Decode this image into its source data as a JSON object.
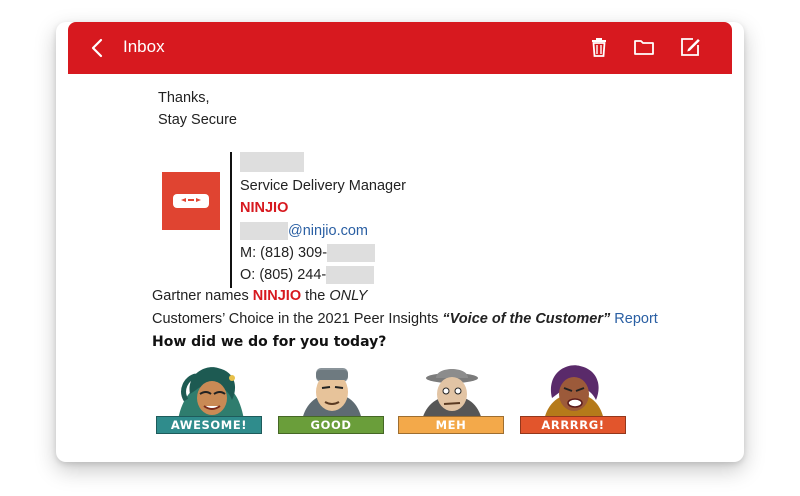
{
  "header": {
    "title": "Inbox"
  },
  "icons": {
    "back": "chevron-left-icon",
    "delete": "trash-icon",
    "folder": "folder-icon",
    "compose": "compose-icon"
  },
  "body": {
    "closing_line1": "Thanks,",
    "closing_line2": "Stay Secure"
  },
  "signature": {
    "role": "Service Delivery Manager",
    "company": "NINJIO",
    "email_domain": "@ninjio.com",
    "mobile_prefix": "M: (818) 309-",
    "office_prefix": "O: (805) 244-"
  },
  "promo": {
    "line1_pre": "Gartner names ",
    "line1_brand": "NINJIO",
    "line1_mid": " the ",
    "line1_em": "ONLY",
    "line2_pre": "Customers’ Choice in the 2021 Peer Insights ",
    "line2_quote": "“Voice of the Customer”",
    "line2_link": " Report"
  },
  "feedback": {
    "question": "How did we do for you today?",
    "options": [
      {
        "label": "AWESOME!",
        "color": "#2f8c8c"
      },
      {
        "label": "GOOD",
        "color": "#6a9e3a"
      },
      {
        "label": "MEH",
        "color": "#f3a94a"
      },
      {
        "label": "ARRRRG!",
        "color": "#e2552c"
      }
    ]
  },
  "colors": {
    "header": "#d7191f",
    "brand": "#d7191f",
    "link": "#2a5fa3"
  }
}
